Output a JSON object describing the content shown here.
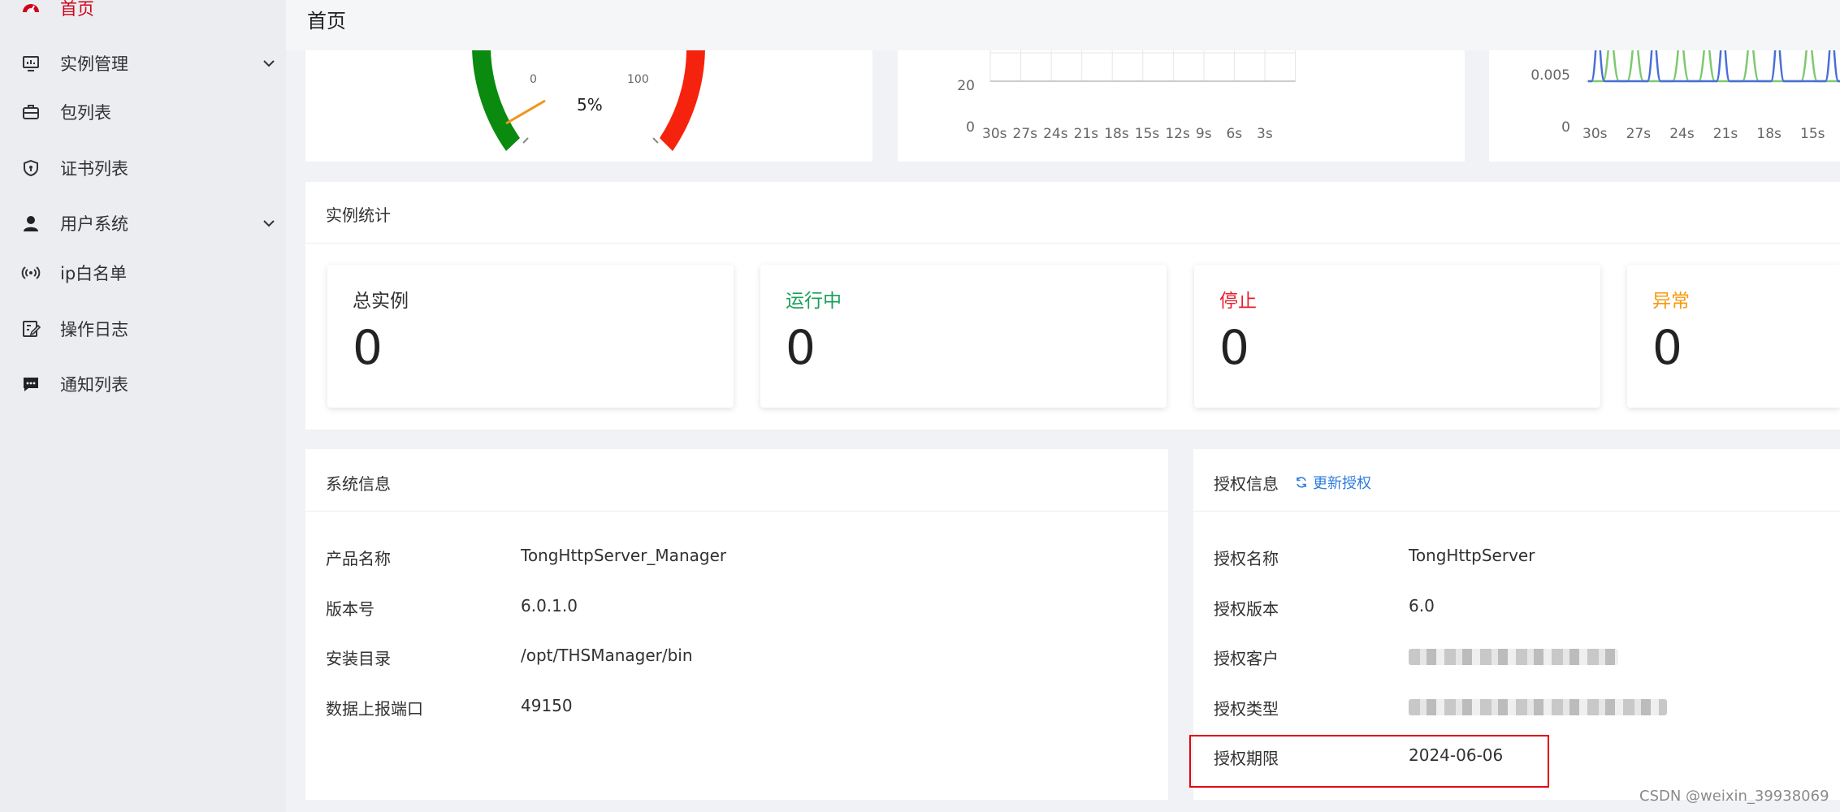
{
  "sidebar": {
    "items": [
      {
        "label": "首页",
        "icon": "dashboard-icon",
        "active": true
      },
      {
        "label": "实例管理",
        "icon": "monitor-icon",
        "has_submenu": true
      },
      {
        "label": "包列表",
        "icon": "package-icon"
      },
      {
        "label": "证书列表",
        "icon": "certificate-icon"
      },
      {
        "label": "用户系统",
        "icon": "user-icon",
        "has_submenu": true
      },
      {
        "label": "ip白名单",
        "icon": "broadcast-icon"
      },
      {
        "label": "操作日志",
        "icon": "edit-log-icon"
      },
      {
        "label": "通知列表",
        "icon": "message-icon"
      }
    ]
  },
  "header": {
    "title": "首页"
  },
  "gauge": {
    "min_label": "0",
    "max_label": "100",
    "value_label": "5%",
    "value": 5
  },
  "chart_data": [
    {
      "type": "line",
      "title": "",
      "x_ticks": [
        "30s",
        "27s",
        "24s",
        "21s",
        "18s",
        "15s",
        "12s",
        "9s",
        "6s",
        "3s"
      ],
      "y_ticks": [
        "0",
        "20"
      ],
      "grid": true
    },
    {
      "type": "line",
      "title": "",
      "x_ticks": [
        "30s",
        "27s",
        "24s",
        "21s",
        "18s",
        "15s"
      ],
      "y_ticks": [
        "0",
        "0.005"
      ],
      "series_colors": [
        "#4a6ed8",
        "#7dc96f"
      ]
    }
  ],
  "instance_stats": {
    "title": "实例统计",
    "cards": [
      {
        "label": "总实例",
        "value": "0",
        "color": "#303133"
      },
      {
        "label": "运行中",
        "value": "0",
        "color": "#18a058"
      },
      {
        "label": "停止",
        "value": "0",
        "color": "#e5212d"
      },
      {
        "label": "异常",
        "value": "0",
        "color": "#f59a0d"
      }
    ]
  },
  "system_info": {
    "title": "系统信息",
    "rows": [
      {
        "label": "产品名称",
        "value": "TongHttpServer_Manager"
      },
      {
        "label": "版本号",
        "value": "6.0.1.0"
      },
      {
        "label": "安装目录",
        "value": "/opt/THSManager/bin"
      },
      {
        "label": "数据上报端口",
        "value": "49150"
      }
    ]
  },
  "license_info": {
    "title": "授权信息",
    "refresh_label": "更新授权",
    "rows": [
      {
        "label": "授权名称",
        "value": "TongHttpServer"
      },
      {
        "label": "授权版本",
        "value": "6.0"
      },
      {
        "label": "授权客户",
        "value": ""
      },
      {
        "label": "授权类型",
        "value": ""
      },
      {
        "label": "授权期限",
        "value": "2024-06-06"
      }
    ]
  },
  "watermark": "CSDN @weixin_39938069"
}
